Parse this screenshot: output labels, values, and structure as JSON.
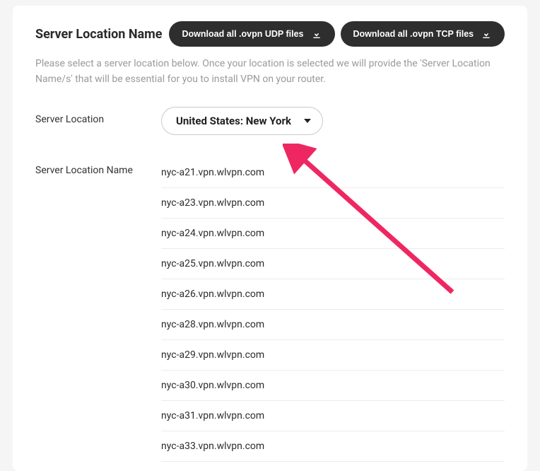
{
  "header": {
    "title": "Server Location Name",
    "download_udp_label": "Download all .ovpn UDP files",
    "download_tcp_label": "Download all .ovpn TCP files"
  },
  "description": "Please select a server location below. Once your location is selected we will provide the 'Server Location Name/s' that will be essential for you to install VPN on your router.",
  "fields": {
    "server_location_label": "Server Location",
    "server_location_value": "United States: New York",
    "server_location_name_label": "Server Location Name"
  },
  "servers": [
    "nyc-a21.vpn.wlvpn.com",
    "nyc-a23.vpn.wlvpn.com",
    "nyc-a24.vpn.wlvpn.com",
    "nyc-a25.vpn.wlvpn.com",
    "nyc-a26.vpn.wlvpn.com",
    "nyc-a28.vpn.wlvpn.com",
    "nyc-a29.vpn.wlvpn.com",
    "nyc-a30.vpn.wlvpn.com",
    "nyc-a31.vpn.wlvpn.com",
    "nyc-a33.vpn.wlvpn.com"
  ],
  "annotation": {
    "arrow_color": "#ee2762"
  }
}
